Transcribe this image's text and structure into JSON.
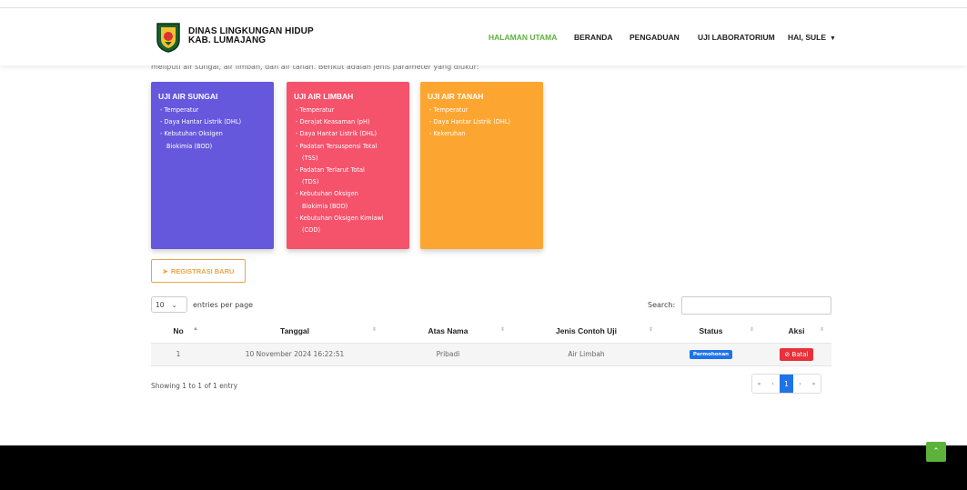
{
  "header": {
    "brand_line1": "DINAS LINGKUNGAN HIDUP",
    "brand_line2": "KAB. LUMAJANG",
    "nav": [
      {
        "label": "HALAMAN UTAMA",
        "active": true
      },
      {
        "label": "BERANDA",
        "active": false
      },
      {
        "label": "PENGADUAN",
        "active": false
      },
      {
        "label": "UJI LABORATORIUM",
        "active": false
      },
      {
        "label": "HAI, SULE",
        "active": false
      }
    ]
  },
  "intro_text_partial": "meliputi air sungai, air limbah, dan air tanah. Berikut adalah jenis parameter yang diukur:",
  "cards": [
    {
      "title": "UJI AIR SUNGAI",
      "items": [
        "- Temperatur",
        "- Daya Hantar Listrik (DHL)",
        "- Kebutuhan Oksigen",
        "Biokimia (BOD)"
      ],
      "color": "#6558dd"
    },
    {
      "title": "UJI AIR LIMBAH",
      "items": [
        "- Temperatur",
        "- Derajat Keasaman (pH)",
        "- Daya Hantar Listrik (DHL)",
        "- Padatan Tersuspensi Total",
        "(TSS)",
        "- Padatan Terlarut Total",
        "(TDS)",
        "- Kebutuhan Oksigen",
        "Biokimia (BOD)",
        "- Kebutuhan Oksigen Kimiawi",
        "(COD)"
      ],
      "color": "#f5526c"
    },
    {
      "title": "UJI AIR TANAH",
      "items": [
        "- Temperatur",
        "- Daya Hantar Listrik (DHL)",
        "- Kekeruhan"
      ],
      "color": "#fca631"
    }
  ],
  "register_button": "REGISTRASI BARU",
  "table_controls": {
    "entries_value": "10",
    "entries_label": "entries per page",
    "search_label": "Search:"
  },
  "table": {
    "columns": [
      "No",
      "Tanggal",
      "Atas Nama",
      "Jenis Contoh Uji",
      "Status",
      "Aksi"
    ],
    "rows": [
      {
        "no": "1",
        "tanggal": "10 November 2024 16:22:51",
        "atas_nama": "Pribadi",
        "jenis": "Air Limbah",
        "status": "Permohonan",
        "aksi": "Batal"
      }
    ]
  },
  "footer_info": {
    "showing": "Showing 1 to 1 of 1 entry",
    "pager": [
      "«",
      "‹",
      "1",
      "›",
      "»"
    ],
    "current_page": "1"
  },
  "colors": {
    "accent_green": "#5cb23a",
    "primary_blue": "#1f73e8",
    "danger_red": "#e8313a",
    "register_border": "#e7a64a"
  }
}
